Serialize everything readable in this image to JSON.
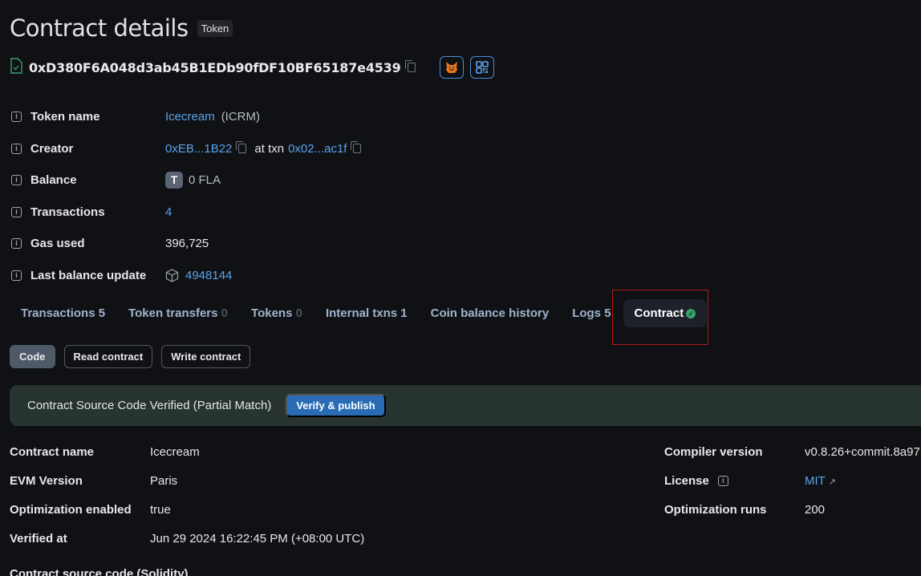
{
  "header": {
    "title": "Contract details",
    "type_badge": "Token",
    "address": "0xD380F6A048d3ab45B1EDb90fDF10BF65187e4539"
  },
  "details": [
    {
      "label": "Token name",
      "value": "Icecream",
      "extra": "(ICRM)"
    },
    {
      "label": "Creator",
      "value": "0xEB...1B22",
      "mid": "at txn",
      "extra": "0x02...ac1f"
    },
    {
      "label": "Balance",
      "badge": "T",
      "value": "0 FLA"
    },
    {
      "label": "Transactions",
      "value": "4"
    },
    {
      "label": "Gas used",
      "value": "396,725"
    },
    {
      "label": "Last balance update",
      "value": "4948144"
    }
  ],
  "tabs": [
    {
      "label": "Transactions",
      "count": "5"
    },
    {
      "label": "Token transfers",
      "count": "0"
    },
    {
      "label": "Tokens",
      "count": "0"
    },
    {
      "label": "Internal txns",
      "count": "1"
    },
    {
      "label": "Coin balance history",
      "count": ""
    },
    {
      "label": "Logs",
      "count": "5"
    },
    {
      "label": "Contract",
      "count": "",
      "active": true
    }
  ],
  "subtabs": [
    "Code",
    "Read contract",
    "Write contract"
  ],
  "banner": {
    "text": "Contract Source Code Verified (Partial Match)",
    "button": "Verify & publish"
  },
  "meta_left": [
    {
      "label": "Contract name",
      "value": "Icecream"
    },
    {
      "label": "EVM Version",
      "value": "Paris"
    },
    {
      "label": "Optimization enabled",
      "value": "true"
    },
    {
      "label": "Verified at",
      "value": "Jun 29 2024 16:22:45 PM (+08:00 UTC)"
    }
  ],
  "meta_right": [
    {
      "label": "Compiler version",
      "value": "v0.8.26+commit.8a97"
    },
    {
      "label": "License",
      "value": "MIT"
    },
    {
      "label": "Optimization runs",
      "value": "200"
    }
  ],
  "section_cut": "Contract source code (Solidity)",
  "colors": {
    "accent": "#5aa3ee",
    "verified": "#38a169",
    "banner": "#273430",
    "button": "#2a6bb5"
  }
}
